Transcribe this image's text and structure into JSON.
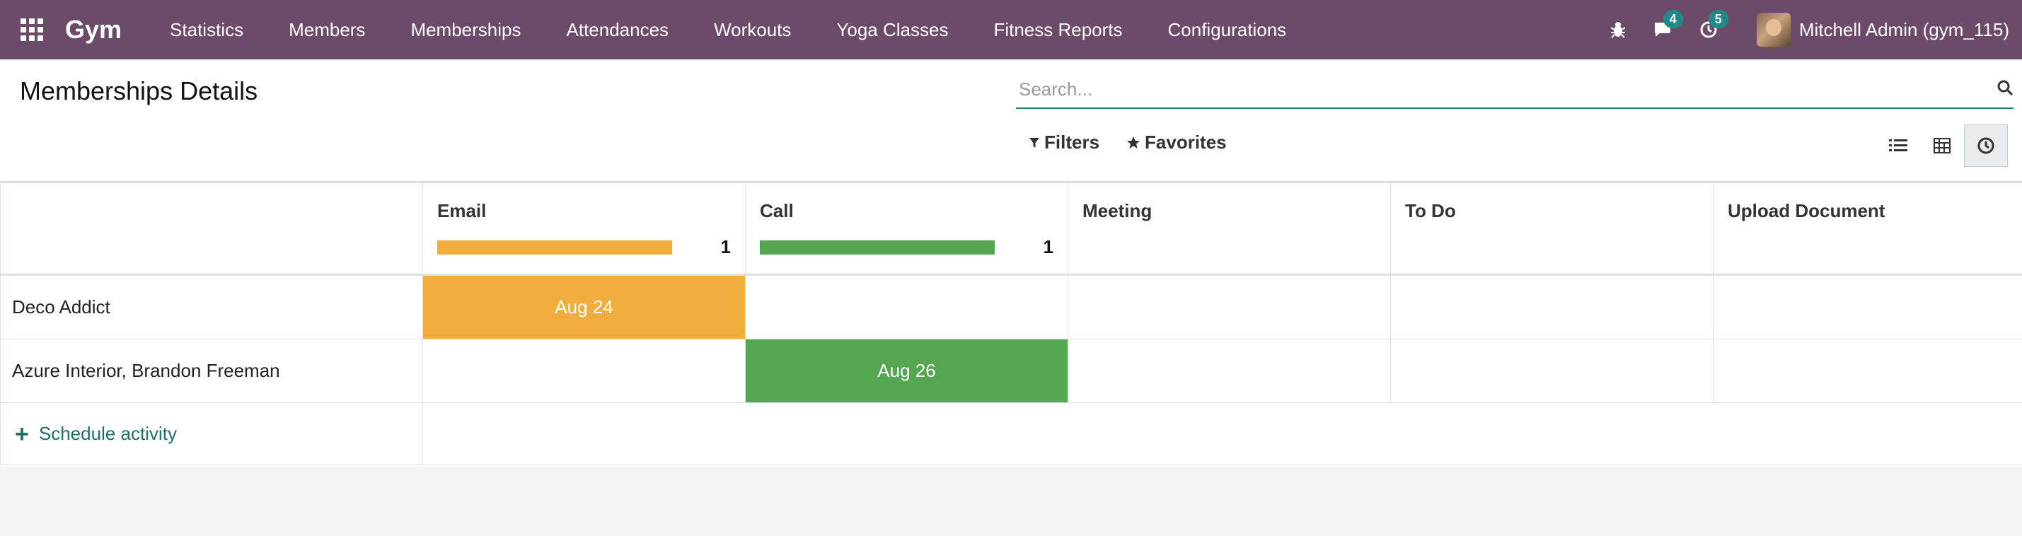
{
  "navbar": {
    "app_name": "Gym",
    "menu": [
      "Statistics",
      "Members",
      "Memberships",
      "Attendances",
      "Workouts",
      "Yoga Classes",
      "Fitness Reports",
      "Configurations"
    ],
    "messages_count": "4",
    "activities_count": "5",
    "user_name": "Mitchell Admin (gym_115)"
  },
  "control": {
    "title": "Memberships Details",
    "search_placeholder": "Search...",
    "filters_label": "Filters",
    "favorites_label": "Favorites"
  },
  "activity": {
    "columns": [
      {
        "label": "Email",
        "count": "1",
        "progress": 1.0,
        "color": "#f1ae3d"
      },
      {
        "label": "Call",
        "count": "1",
        "progress": 1.0,
        "color": "#54a650"
      },
      {
        "label": "Meeting"
      },
      {
        "label": "To Do"
      },
      {
        "label": "Upload Document"
      }
    ],
    "rows": [
      {
        "name": "Deco Addict",
        "email": "Aug 24"
      },
      {
        "name": "Azure Interior, Brandon Freeman",
        "call": "Aug 26"
      }
    ],
    "schedule_label": "Schedule activity"
  },
  "colors": {
    "navbar": "#6c4a69",
    "email": "#f1ae3d",
    "call": "#54a650",
    "link": "#1f6f6c"
  }
}
